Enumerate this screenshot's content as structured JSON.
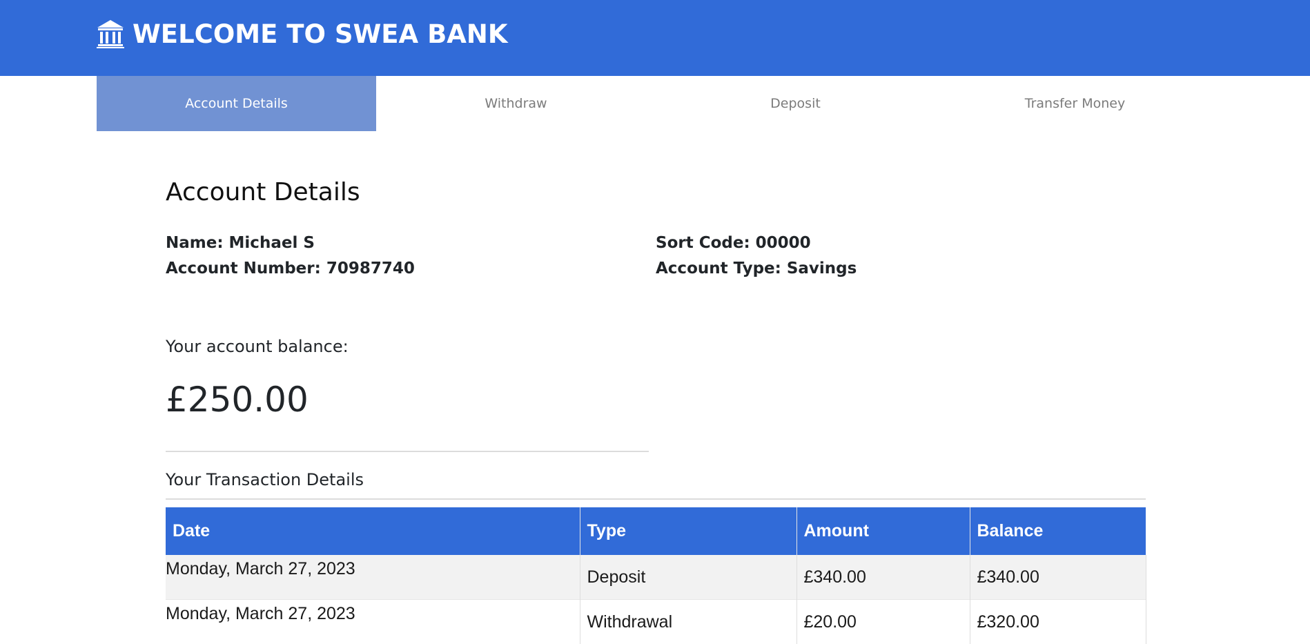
{
  "header": {
    "title": "WELCOME TO SWEA BANK",
    "icon": "bank-icon",
    "background_color": "#316bd8"
  },
  "tabs": [
    {
      "label": "Account Details",
      "active": true
    },
    {
      "label": "Withdraw",
      "active": false
    },
    {
      "label": "Deposit",
      "active": false
    },
    {
      "label": "Transfer Money",
      "active": false
    }
  ],
  "account": {
    "section_title": "Account Details",
    "name": "Name: Michael S",
    "account_number": "Account Number: 70987740",
    "sort_code": "Sort Code: 00000",
    "account_type": "Account Type: Savings"
  },
  "balance": {
    "label": "Your account balance:",
    "value": "£250.00"
  },
  "transactions": {
    "title": "Your Transaction Details",
    "columns": [
      "Date",
      "Type",
      "Amount",
      "Balance"
    ],
    "rows": [
      {
        "date": "Monday, March 27, 2023",
        "type": "Deposit",
        "amount": "£340.00",
        "balance": "£340.00"
      },
      {
        "date": "Monday, March 27, 2023",
        "type": "Withdrawal",
        "amount": "£20.00",
        "balance": "£320.00"
      }
    ]
  },
  "colors": {
    "accent": "#316bd8",
    "active_tab": "#7192d3",
    "inactive_tab_text": "#7b7b7b"
  }
}
